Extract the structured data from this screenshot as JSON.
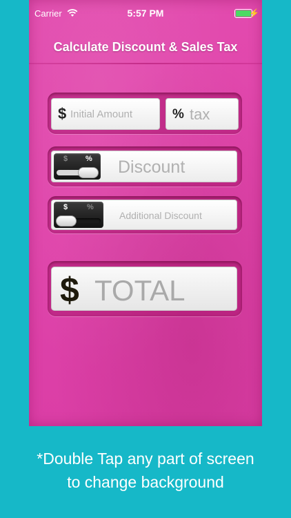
{
  "status_bar": {
    "carrier": "Carrier",
    "time": "5:57 PM",
    "battery_color": "#4cd964"
  },
  "header": {
    "title": "Calculate Discount & Sales Tax"
  },
  "inputs": {
    "initial_amount": {
      "symbol": "$",
      "placeholder": "Initial Amount"
    },
    "tax": {
      "symbol": "%",
      "placeholder": "tax"
    },
    "discount": {
      "placeholder": "Discount",
      "toggle_left": "$",
      "toggle_right": "%",
      "toggle_selected": "%"
    },
    "additional_discount": {
      "placeholder": "Additional Discount",
      "toggle_left": "$",
      "toggle_right": "%",
      "toggle_selected": "$"
    }
  },
  "total": {
    "symbol": "$",
    "label": "TOTAL"
  },
  "footer": {
    "line1": "*Double Tap any part of screen",
    "line2": "to change background"
  },
  "colors": {
    "outer_background": "#16b8c8",
    "app_background": "#e045ab",
    "accent_text": "#ffffff"
  }
}
